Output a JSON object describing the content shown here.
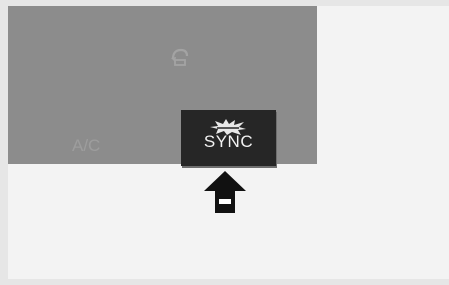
{
  "screen": {
    "background_color": "#f3f3f3",
    "panel_color": "#8c8c8c"
  },
  "panel": {
    "ghost_label": "A/C",
    "ghost_icon": "recirculation-icon"
  },
  "sync_button": {
    "label": "SYNC",
    "burst_icon": "sync-burst-icon",
    "background_color": "#262626",
    "text_color": "#f2f2f2"
  },
  "pointer": {
    "icon": "up-arrow-icon",
    "fill_color": "#111111",
    "inner_color": "#ffffff"
  }
}
